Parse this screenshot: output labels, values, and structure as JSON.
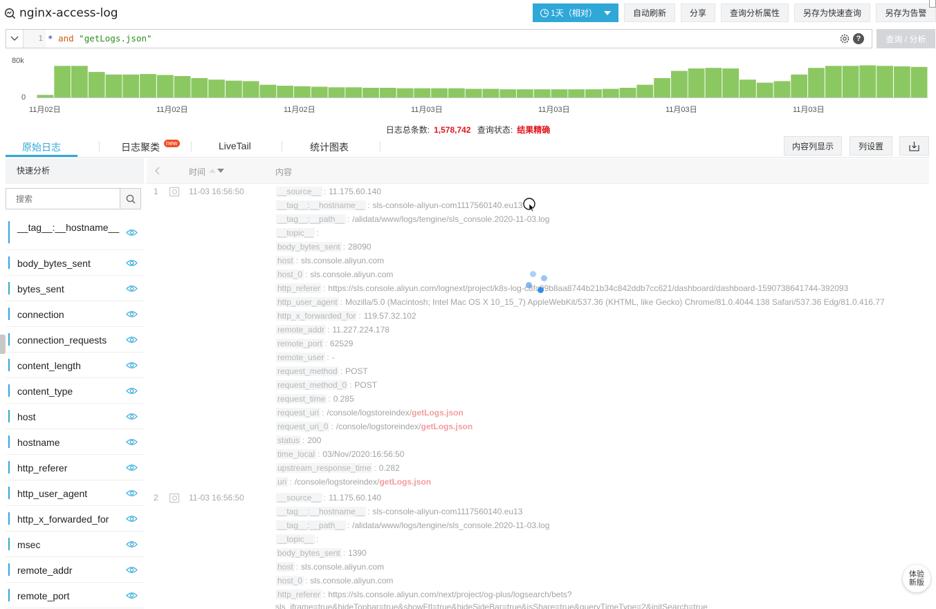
{
  "header": {
    "title": "nginx-access-log",
    "time_range": "1天（相对）",
    "buttons": [
      "自动刷新",
      "分享",
      "查询分析属性",
      "另存为快速查询",
      "另存为告警"
    ]
  },
  "query": {
    "line_number": "1",
    "star": "*",
    "op": "and",
    "term": "\"getLogs.json\"",
    "run_label": "查询 / 分析"
  },
  "histogram": {
    "y_max_label": "80k",
    "y_min_label": "0",
    "x_labels": [
      "11月02日",
      "11月02日",
      "11月02日",
      "11月03日",
      "11月03日",
      "11月03日",
      "11月03日"
    ],
    "bar_color": "#8cc862",
    "y_max": 80000,
    "values": [
      5000,
      62000,
      62000,
      50000,
      45000,
      45000,
      46000,
      44000,
      42000,
      38000,
      35000,
      33000,
      32000,
      25000,
      23000,
      22000,
      21000,
      20000,
      20000,
      19000,
      19000,
      18000,
      18000,
      18000,
      18000,
      17000,
      17000,
      16000,
      16000,
      16000,
      16000,
      16000,
      16000,
      17000,
      19000,
      25000,
      38000,
      52000,
      57000,
      58000,
      57000,
      35000,
      29000,
      32000,
      45000,
      58000,
      62000,
      62000,
      63000,
      62000,
      61000,
      60000
    ]
  },
  "summary": {
    "count_label": "日志总条数:",
    "count": "1,578,742",
    "status_label": "查询状态:",
    "status": "结果精确"
  },
  "tabs": {
    "items": [
      "原始日志",
      "日志聚类",
      "LiveTail",
      "统计图表"
    ],
    "active": 0,
    "new_badge": "new",
    "buttons": [
      "内容列显示",
      "列设置"
    ]
  },
  "sidebar": {
    "title": "快速分析",
    "search_placeholder": "搜索",
    "fields": [
      "__tag__:__hostname__",
      "body_bytes_sent",
      "bytes_sent",
      "connection",
      "connection_requests",
      "content_length",
      "content_type",
      "host",
      "hostname",
      "http_referer",
      "http_user_agent",
      "http_x_forwarded_for",
      "msec",
      "remote_addr",
      "remote_port"
    ]
  },
  "log_table": {
    "col_time": "时间",
    "col_content": "内容",
    "rows": [
      {
        "index": "1",
        "time": "11-03 16:56:50",
        "fields": [
          {
            "k": "__source__",
            "v": "11.175.60.140"
          },
          {
            "k": "__tag__:__hostname__",
            "v": "sls-console-aliyun-com1117560140.eu13"
          },
          {
            "k": "__tag__:__path__",
            "v": "/alidata/www/logs/tengine/sls_console.2020-11-03.log"
          },
          {
            "k": "__topic__",
            "v": ""
          },
          {
            "k": "body_bytes_sent",
            "v": "28090"
          },
          {
            "k": "host",
            "v": "sls.console.aliyun.com"
          },
          {
            "k": "host_0",
            "v": "sls.console.aliyun.com"
          },
          {
            "k": "http_referer",
            "v": "https://sls.console.aliyun.com/lognext/project/k8s-log-c8fc99b8aa8744b21b34c842ddb7cc621/dashboard/dashboard-1590738641744-392093"
          },
          {
            "k": "http_user_agent",
            "v": "Mozilla/5.0 (Macintosh; Intel Mac OS X 10_15_7) AppleWebKit/537.36 (KHTML, like Gecko) Chrome/81.0.4044.138 Safari/537.36 Edg/81.0.416.77"
          },
          {
            "k": "http_x_forwarded_for",
            "v": "119.57.32.102"
          },
          {
            "k": "remote_addr",
            "v": "11.227.224.178"
          },
          {
            "k": "remote_port",
            "v": "62529"
          },
          {
            "k": "remote_user",
            "v": "-"
          },
          {
            "k": "request_method",
            "v": "POST"
          },
          {
            "k": "request_method_0",
            "v": "POST"
          },
          {
            "k": "request_time",
            "v": "0.285"
          },
          {
            "k": "request_uri",
            "v": "/console/logstoreindex/",
            "hl": "getLogs.json"
          },
          {
            "k": "request_uri_0",
            "v": "/console/logstoreindex/",
            "hl": "getLogs.json"
          },
          {
            "k": "status",
            "v": "200"
          },
          {
            "k": "time_local",
            "v": "03/Nov/2020:16:56:50"
          },
          {
            "k": "upstream_response_time",
            "v": "0.282"
          },
          {
            "k": "uri",
            "v": "/console/logstoreindex/",
            "hl": "getLogs.json"
          }
        ]
      },
      {
        "index": "2",
        "time": "11-03 16:56:50",
        "fields": [
          {
            "k": "__source__",
            "v": "11.175.60.140"
          },
          {
            "k": "__tag__:__hostname__",
            "v": "sls-console-aliyun-com1117560140.eu13"
          },
          {
            "k": "__tag__:__path__",
            "v": "/alidata/www/logs/tengine/sls_console.2020-11-03.log"
          },
          {
            "k": "__topic__",
            "v": ""
          },
          {
            "k": "body_bytes_sent",
            "v": "1390"
          },
          {
            "k": "host",
            "v": "sls.console.aliyun.com"
          },
          {
            "k": "host_0",
            "v": "sls.console.aliyun.com"
          },
          {
            "k": "http_referer",
            "v": "https://sls.console.aliyun.com/next/project/og-plus/logsearch/bets?"
          }
        ],
        "wrap_line": "sls_iframe=true&hideTopbar=true&showFtl=true&hideSideBar=true&isShare=true&queryTimeType=2&initSearch=true"
      }
    ]
  },
  "fab": {
    "line1": "体验",
    "line2": "新版"
  },
  "colors": {
    "accent": "#2fa8d8",
    "highlight": "#e0141c",
    "bar": "#8cc862"
  }
}
